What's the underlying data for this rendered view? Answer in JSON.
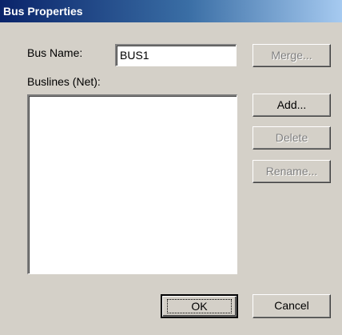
{
  "window": {
    "title": "Bus Properties"
  },
  "form": {
    "bus_name_label": "Bus Name:",
    "bus_name_value": "BUS1",
    "buslines_label": "Buslines (Net):",
    "buslines_items": []
  },
  "buttons": {
    "merge": "Merge...",
    "add": "Add...",
    "delete": "Delete",
    "rename": "Rename...",
    "ok": "OK",
    "cancel": "Cancel"
  },
  "colors": {
    "dialog_face": "#d4d0c8",
    "titlebar_start": "#0a246a",
    "titlebar_end": "#a6caf0",
    "disabled_text": "#808080"
  }
}
